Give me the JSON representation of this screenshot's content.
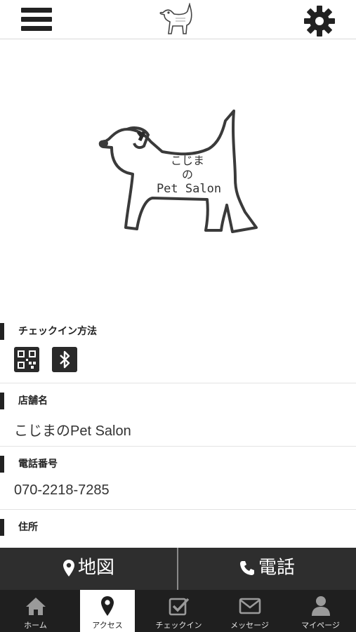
{
  "header": {
    "menu_icon": "hamburger-menu-icon",
    "logo_icon": "dog-logo-icon",
    "settings_icon": "gear-icon"
  },
  "hero": {
    "logo_line1": "こじま",
    "logo_line2": "の",
    "logo_line3": "Pet Salon"
  },
  "sections": {
    "checkin": {
      "title": "チェックイン方法",
      "icons": [
        "qr-code-icon",
        "bluetooth-icon"
      ]
    },
    "shop_name": {
      "title": "店舗名",
      "value": "こじまのPet Salon"
    },
    "phone": {
      "title": "電話番号",
      "value": "070-2218-7285"
    },
    "address": {
      "title": "住所"
    }
  },
  "actions": {
    "map_label": "地図",
    "call_label": "電話"
  },
  "tabs": [
    {
      "label": "ホーム",
      "icon": "home-icon"
    },
    {
      "label": "アクセス",
      "icon": "map-pin-icon",
      "active": true
    },
    {
      "label": "チェックイン",
      "icon": "checkbox-icon"
    },
    {
      "label": "メッセージ",
      "icon": "envelope-icon"
    },
    {
      "label": "マイページ",
      "icon": "user-icon"
    }
  ],
  "colors": {
    "bar_dark": "#2e2e2e",
    "tabbar": "#1f1f1f",
    "accent": "#222222"
  }
}
